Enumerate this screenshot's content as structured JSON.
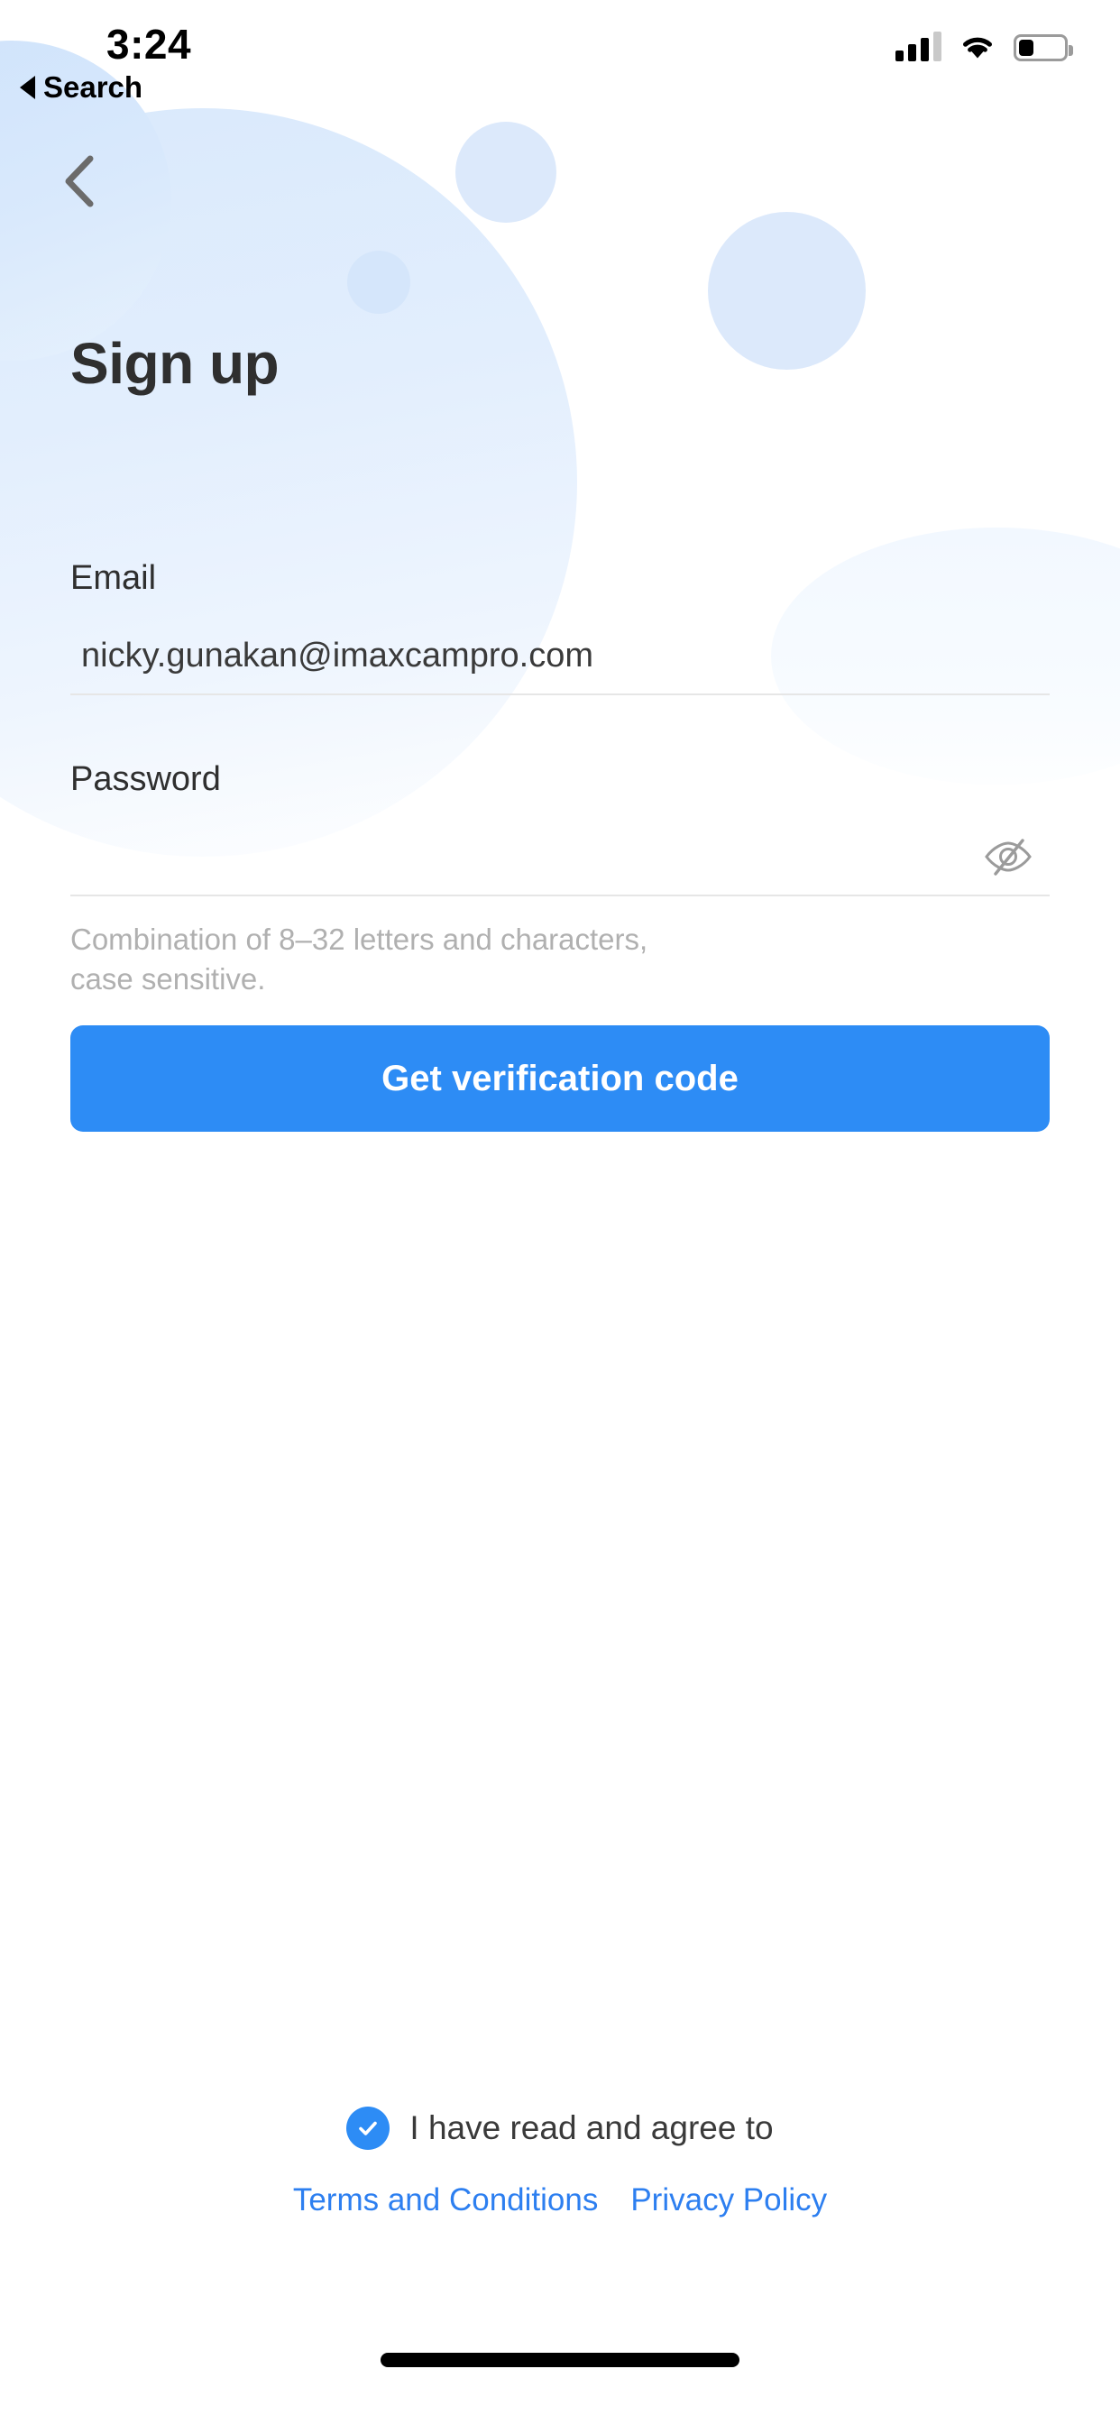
{
  "status_bar": {
    "time": "3:24",
    "back_to_app_label": "Search",
    "cellular_bars_filled": 3,
    "cellular_bars_total": 4,
    "wifi": "full",
    "battery_percent": 30
  },
  "nav": {
    "back_icon": "chevron-left-icon"
  },
  "page": {
    "title": "Sign up"
  },
  "form": {
    "email": {
      "label": "Email",
      "value": "nicky.gunakan@imaxcampro.com",
      "placeholder": "Email"
    },
    "password": {
      "label": "Password",
      "value": "",
      "placeholder": "",
      "toggle_icon": "eye-off-icon",
      "hint": "Combination of 8–32 letters and characters, case sensitive."
    },
    "submit_label": "Get verification code"
  },
  "footer": {
    "agree_text": "I have read and agree to",
    "checkbox_checked": true,
    "links": [
      {
        "label": "Terms and Conditions"
      },
      {
        "label": "Privacy Policy"
      }
    ]
  },
  "colors": {
    "accent": "#2d8cf5",
    "link": "#2d7ff0",
    "text_primary": "#2f2f2f",
    "hint": "#b0b0b0",
    "decor_blue": "#dce9fb",
    "underline": "#e6e6e6"
  }
}
